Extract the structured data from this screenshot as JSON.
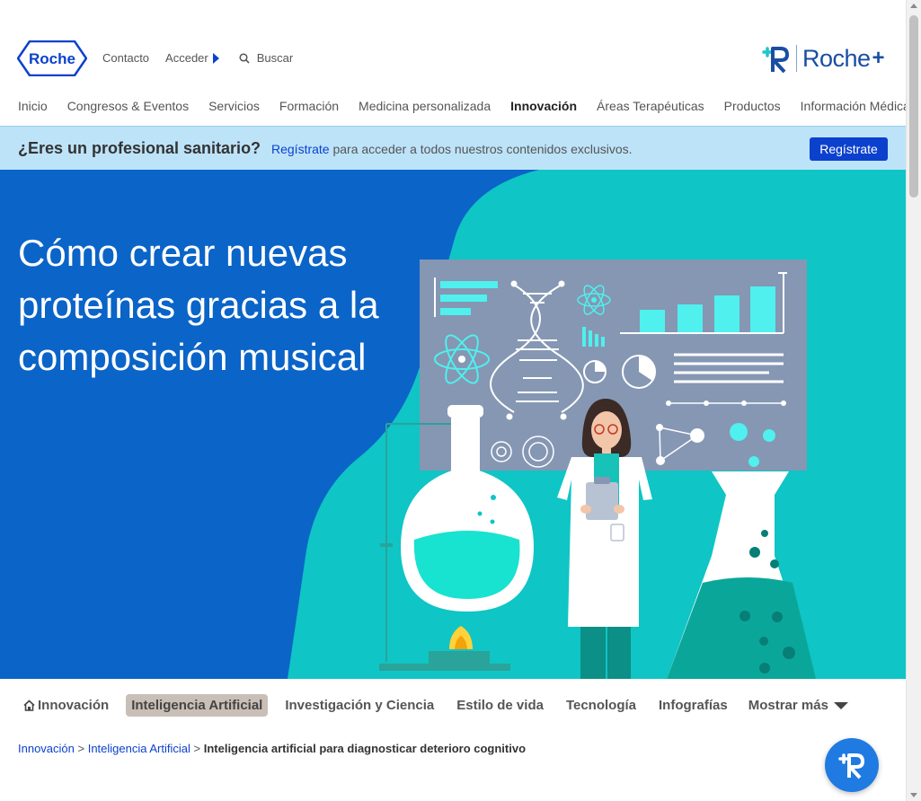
{
  "header": {
    "logo_text": "Roche",
    "links": {
      "contacto": "Contacto",
      "acceder": "Acceder",
      "buscar": "Buscar"
    },
    "rocheplus": {
      "name": "Roche",
      "plus": "+"
    }
  },
  "nav": {
    "items": [
      {
        "label": "Inicio"
      },
      {
        "label": "Congresos & Eventos"
      },
      {
        "label": "Servicios"
      },
      {
        "label": "Formación"
      },
      {
        "label": "Medicina personalizada"
      },
      {
        "label": "Innovación"
      },
      {
        "label": "Áreas Terapéuticas"
      },
      {
        "label": "Productos"
      },
      {
        "label": "Información Médica"
      }
    ],
    "active": "Innovación"
  },
  "pro_banner": {
    "question": "¿Eres un profesional sanitario?",
    "link": "Regístrate",
    "text": " para acceder a todos nuestros contenidos exclusivos.",
    "button": "Regístrate"
  },
  "hero": {
    "title": "Cómo crear nuevas proteínas gracias a la composición musical",
    "colors": {
      "blue": "#0b64c8",
      "teal": "#0fc5c5",
      "board": "#8597b3"
    }
  },
  "categories": {
    "items": [
      {
        "label": "Innovación",
        "icon": "home-icon"
      },
      {
        "label": "Inteligencia Artificial",
        "selected": true
      },
      {
        "label": "Investigación y Ciencia"
      },
      {
        "label": "Estilo de vida"
      },
      {
        "label": "Tecnología"
      },
      {
        "label": "Infografías"
      }
    ],
    "more": "Mostrar más"
  },
  "breadcrumb": {
    "level1": "Innovación",
    "sep": " > ",
    "level2": "Inteligencia Artificial",
    "current": "Inteligencia artificial para diagnosticar deterioro cognitivo"
  }
}
